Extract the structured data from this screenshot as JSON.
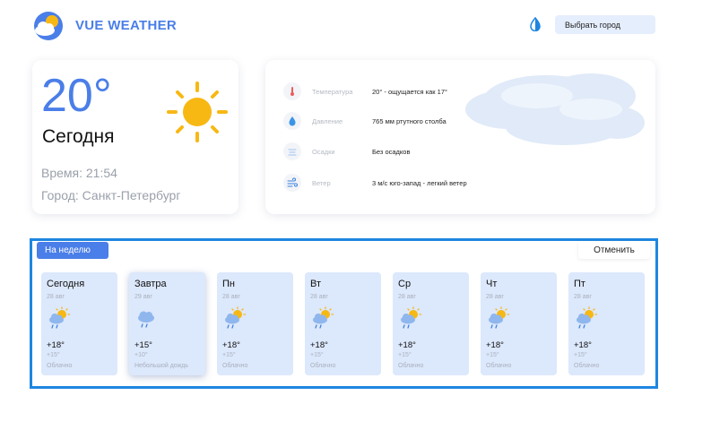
{
  "header": {
    "brand": "VUE WEATHER",
    "city_button": "Выбрать город",
    "icons": {
      "logo": "sun-cloud-logo-icon",
      "theme": "contrast-toggle-icon"
    }
  },
  "today": {
    "temperature": "20°",
    "label": "Сегодня",
    "time": "Время: 21:54",
    "city": "Город: Санкт-Петербург",
    "icon": "sun-icon"
  },
  "details": [
    {
      "icon": "thermometer-icon",
      "name": "Температура",
      "value": "20° - ощущается как 17°"
    },
    {
      "icon": "pressure-drop-icon",
      "name": "Давление",
      "value": "765 мм ртутного столба"
    },
    {
      "icon": "precipitation-icon",
      "name": "Осадки",
      "value": "Без осадков"
    },
    {
      "icon": "wind-icon",
      "name": "Ветер",
      "value": "3 м/с юго-запад - легкий ветер"
    }
  ],
  "week": {
    "tab_label": "На неделю",
    "cancel_label": "Отменить",
    "days": [
      {
        "name": "Сегодня",
        "date": "28 авг",
        "max": "+18°",
        "min": "+15°",
        "desc": "Облачно",
        "icon": "partly-cloudy-rain-icon"
      },
      {
        "name": "Завтра",
        "date": "29 авг",
        "max": "+15°",
        "min": "+10°",
        "desc": "Небольшой дождь",
        "icon": "rain-cloud-icon"
      },
      {
        "name": "Пн",
        "date": "28 авг",
        "max": "+18°",
        "min": "+15°",
        "desc": "Облачно",
        "icon": "partly-cloudy-rain-icon"
      },
      {
        "name": "Вт",
        "date": "28 авг",
        "max": "+18°",
        "min": "+15°",
        "desc": "Облачно",
        "icon": "partly-cloudy-rain-icon"
      },
      {
        "name": "Ср",
        "date": "28 авг",
        "max": "+18°",
        "min": "+15°",
        "desc": "Облачно",
        "icon": "partly-cloudy-rain-icon"
      },
      {
        "name": "Чт",
        "date": "28 авг",
        "max": "+18°",
        "min": "+15°",
        "desc": "Облачно",
        "icon": "partly-cloudy-rain-icon"
      },
      {
        "name": "Пт",
        "date": "28 авг",
        "max": "+18°",
        "min": "+15°",
        "desc": "Облачно",
        "icon": "partly-cloudy-rain-icon"
      }
    ]
  },
  "colors": {
    "accent": "#4a7ee8",
    "selection_border": "#1e86e0",
    "day_card": "#dce8fc",
    "sun": "#f7b814"
  }
}
